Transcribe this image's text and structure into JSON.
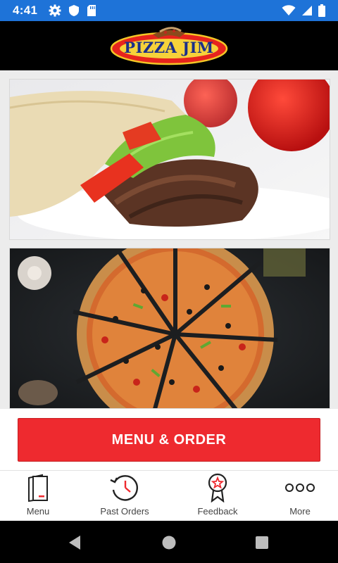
{
  "status_bar": {
    "time": "4:41",
    "icons_left": [
      "settings-icon",
      "shield-icon",
      "sd-card-icon"
    ],
    "icons_right": [
      "wifi-icon",
      "cell-signal-icon",
      "battery-icon"
    ],
    "background": "#1e73d8"
  },
  "header": {
    "logo_text": "PIZZA JIM",
    "background": "#000000"
  },
  "gallery": [
    {
      "name": "kebab-wrap-photo",
      "subject": "doner kebab wrap"
    },
    {
      "name": "pizza-photo",
      "subject": "sliced pizza"
    }
  ],
  "cta": {
    "label": "MENU & ORDER",
    "color": "#ee2a2f"
  },
  "tabs": [
    {
      "label": "Menu",
      "icon": "menu-book-icon"
    },
    {
      "label": "Past Orders",
      "icon": "history-icon"
    },
    {
      "label": "Feedback",
      "icon": "award-ribbon-icon"
    },
    {
      "label": "More",
      "icon": "more-dots-icon"
    }
  ],
  "nav_bar": {
    "buttons": [
      "back-icon",
      "home-icon",
      "recents-icon"
    ]
  }
}
